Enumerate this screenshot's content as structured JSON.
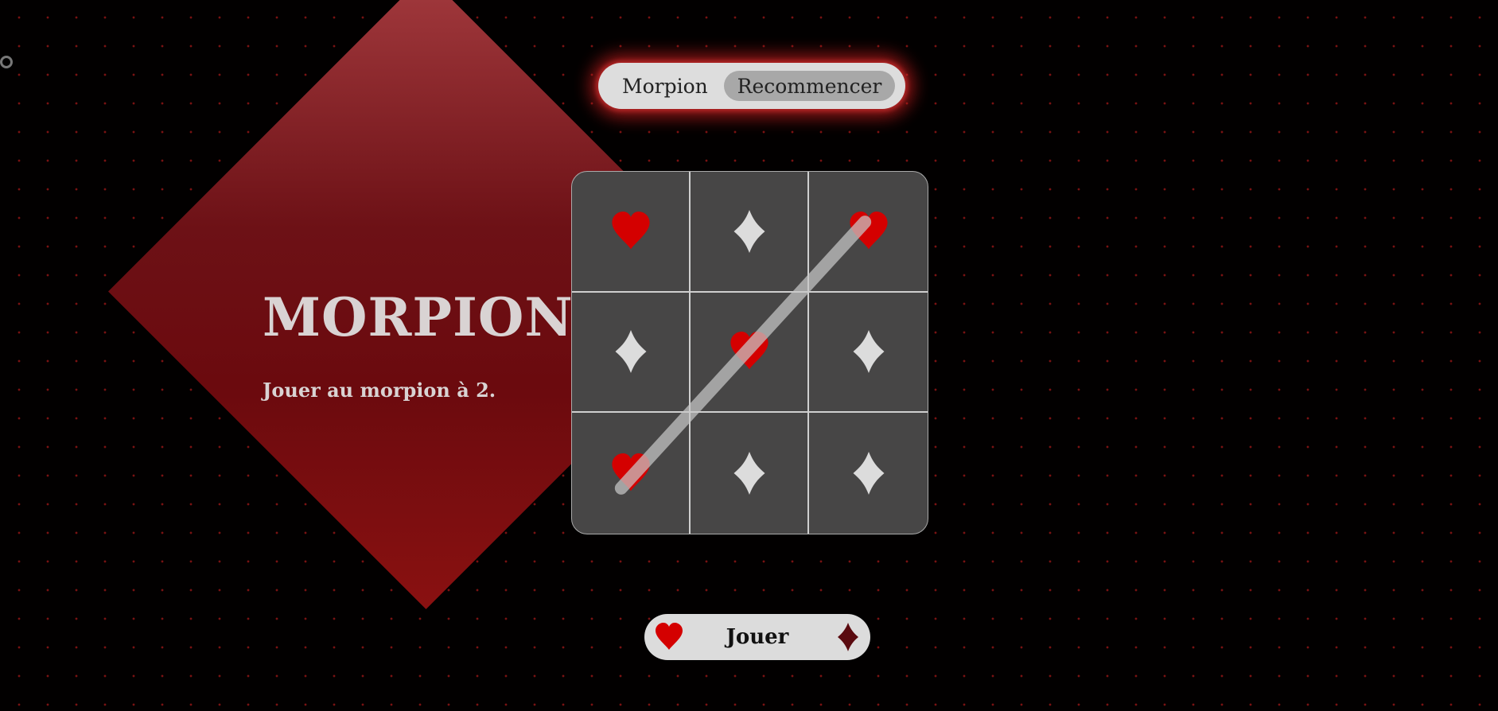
{
  "colors": {
    "accent_red": "#d40000",
    "diamond_light": "#dcdcdc",
    "diamond_dark": "#5a0a0f",
    "board_bg": "#474646"
  },
  "navbar": {
    "brand": "Morpion",
    "restart_label": "Recommencer"
  },
  "hero": {
    "title": "MORPION",
    "subtitle": "Jouer au morpion à 2."
  },
  "board": {
    "cells": [
      "heart",
      "diamond",
      "heart",
      "diamond",
      "heart",
      "diamond",
      "heart",
      "diamond",
      "diamond"
    ],
    "winning_line": [
      2,
      4,
      6
    ]
  },
  "controls": {
    "player1_icon": "heart-icon",
    "play_label": "Jouer",
    "player2_icon": "diamond-icon"
  }
}
